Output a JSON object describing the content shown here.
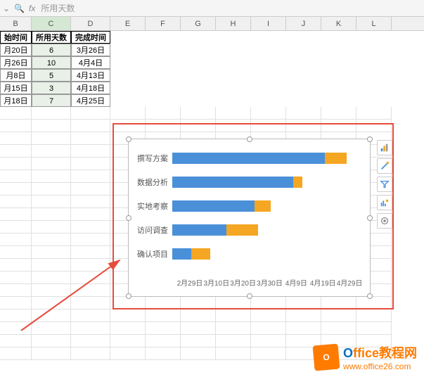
{
  "formula_bar": {
    "value": "所用天数"
  },
  "columns": [
    "B",
    "C",
    "D",
    "E",
    "F",
    "G",
    "H",
    "I",
    "J",
    "K",
    "L"
  ],
  "selected_column": "C",
  "table": {
    "headers": [
      "始时间",
      "所用天数",
      "完成时间"
    ],
    "rows": [
      {
        "start": "月20日",
        "days": "6",
        "end": "3月26日"
      },
      {
        "start": "月26日",
        "days": "10",
        "end": "4月4日"
      },
      {
        "start": "月8日",
        "days": "5",
        "end": "4月13日"
      },
      {
        "start": "月15日",
        "days": "3",
        "end": "4月18日"
      },
      {
        "start": "月18日",
        "days": "7",
        "end": "4月25日"
      }
    ]
  },
  "chart_data": {
    "type": "bar",
    "categories": [
      "撰写方案",
      "数据分析",
      "实地考察",
      "访问调查",
      "确认项目"
    ],
    "series": [
      {
        "name": "开始时间",
        "values": [
          48,
          38,
          26,
          17,
          6
        ],
        "color": "#4a90d9"
      },
      {
        "name": "所用天数",
        "values": [
          7,
          3,
          5,
          10,
          6
        ],
        "color": "#f5a623"
      }
    ],
    "x_ticks": [
      "2月29日",
      "3月10日",
      "3月20日",
      "3月30日",
      "4月9日",
      "4月19日",
      "4月29日"
    ],
    "xlabel": "",
    "ylabel": "",
    "title": "",
    "xlim": [
      0,
      60
    ]
  },
  "chart_tools": [
    "chart-elements",
    "style",
    "filter",
    "chart-type",
    "settings"
  ],
  "watermark": {
    "title_first": "O",
    "title_rest": "ffice教程网",
    "url": "www.office26.com"
  }
}
